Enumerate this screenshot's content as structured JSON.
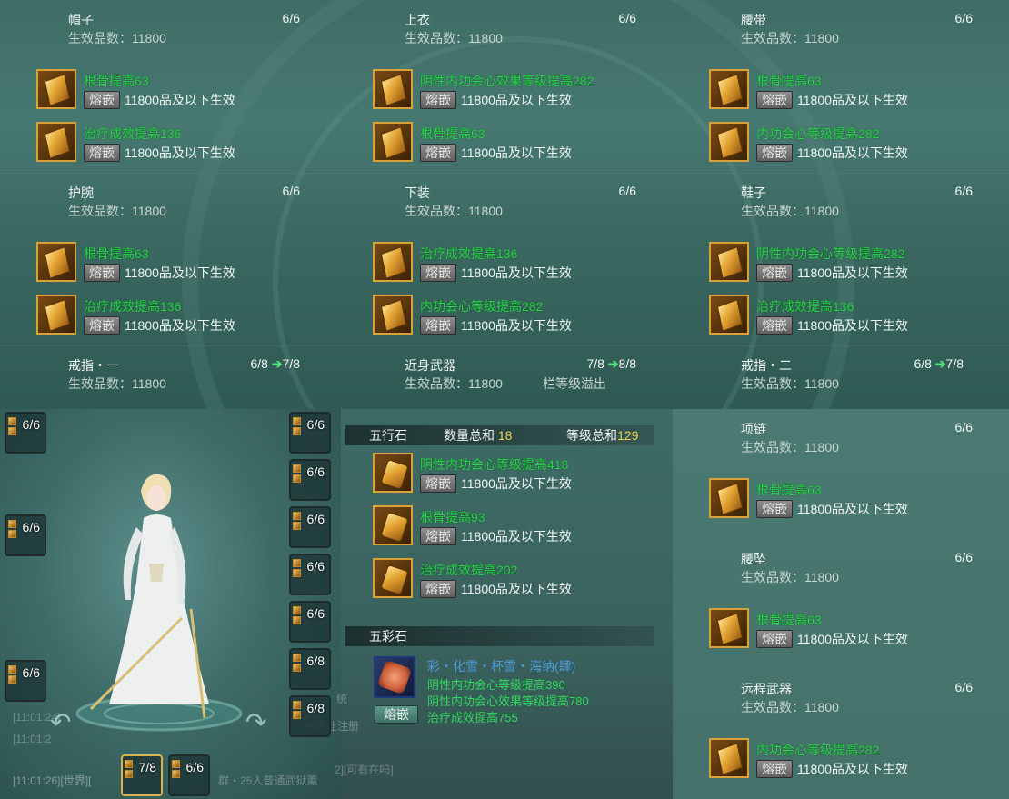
{
  "gear": [
    {
      "id": "hat",
      "name": "帽子",
      "count": "6/6",
      "eff": "生效品数：11800",
      "gems": [
        {
          "attr": "根骨提高63",
          "inlay": "熔嵌",
          "eff": "11800品及以下生效"
        },
        {
          "attr": "治疗成效提高136",
          "inlay": "熔嵌",
          "eff": "11800品及以下生效"
        }
      ]
    },
    {
      "id": "top",
      "name": "上衣",
      "count": "6/6",
      "eff": "生效品数：11800",
      "gems": [
        {
          "attr": "阴性内功会心效果等级提高282",
          "inlay": "熔嵌",
          "eff": "11800品及以下生效"
        },
        {
          "attr": "根骨提高63",
          "inlay": "熔嵌",
          "eff": "11800品及以下生效"
        }
      ]
    },
    {
      "id": "belt",
      "name": "腰带",
      "count": "6/6",
      "eff": "生效品数：11800",
      "gems": [
        {
          "attr": "根骨提高63",
          "inlay": "熔嵌",
          "eff": "11800品及以下生效"
        },
        {
          "attr": "内功会心等级提高282",
          "inlay": "熔嵌",
          "eff": "11800品及以下生效"
        }
      ]
    },
    {
      "id": "wrist",
      "name": "护腕",
      "count": "6/6",
      "eff": "生效品数：11800",
      "gems": [
        {
          "attr": "根骨提高63",
          "inlay": "熔嵌",
          "eff": "11800品及以下生效"
        },
        {
          "attr": "治疗成效提高136",
          "inlay": "熔嵌",
          "eff": "11800品及以下生效"
        }
      ]
    },
    {
      "id": "pants",
      "name": "下装",
      "count": "6/6",
      "eff": "生效品数：11800",
      "gems": [
        {
          "attr": "治疗成效提高136",
          "inlay": "熔嵌",
          "eff": "11800品及以下生效"
        },
        {
          "attr": "内功会心等级提高282",
          "inlay": "熔嵌",
          "eff": "11800品及以下生效"
        }
      ]
    },
    {
      "id": "shoes",
      "name": "鞋子",
      "count": "6/6",
      "eff": "生效品数：11800",
      "gems": [
        {
          "attr": "阴性内功会心等级提高282",
          "inlay": "熔嵌",
          "eff": "11800品及以下生效"
        },
        {
          "attr": "治疗成效提高136",
          "inlay": "熔嵌",
          "eff": "11800品及以下生效"
        }
      ]
    }
  ],
  "ring1": {
    "name": "戒指・一",
    "count": "6/8",
    "count_next": "7/8",
    "eff": "生效品数：11800"
  },
  "weapon": {
    "name": "近身武器",
    "count": "7/8",
    "count_next": "8/8",
    "eff": "生效品数：11800",
    "overflow": "栏等级溢出"
  },
  "ring2": {
    "name": "戒指・二",
    "count": "6/8",
    "count_next": "7/8",
    "eff": "生效品数：11800"
  },
  "arrow": "➔",
  "right_gear": [
    {
      "id": "necklace",
      "name": "项链",
      "count": "6/6",
      "eff": "生效品数：11800",
      "gem": {
        "attr": "根骨提高63",
        "inlay": "熔嵌",
        "eff": "11800品及以下生效"
      }
    },
    {
      "id": "pendant",
      "name": "腰坠",
      "count": "6/6",
      "eff": "生效品数：11800",
      "gem": {
        "attr": "根骨提高63",
        "inlay": "熔嵌",
        "eff": "11800品及以下生效"
      }
    },
    {
      "id": "ranged",
      "name": "远程武器",
      "count": "6/6",
      "eff": "生效品数：11800",
      "gem": {
        "attr": "内功会心等级提高282",
        "inlay": "熔嵌",
        "eff": "11800品及以下生效"
      }
    }
  ],
  "wuxing": {
    "title": "五行石",
    "qty_label": "数量总和",
    "qty": "18",
    "lvl_label": "等级总和",
    "lvl": "129",
    "gems": [
      {
        "attr": "阴性内功会心等级提高418",
        "inlay": "熔嵌",
        "eff": "11800品及以下生效"
      },
      {
        "attr": "根骨提高93",
        "inlay": "熔嵌",
        "eff": "11800品及以下生效"
      },
      {
        "attr": "治疗成效提高202",
        "inlay": "熔嵌",
        "eff": "11800品及以下生效"
      }
    ]
  },
  "wucai": {
    "title": "五彩石",
    "name": "彩・化雪・杯雪・海纳(肆)",
    "inlay": "熔嵌",
    "attrs": [
      "阴性内功会心等级提高390",
      "阴性内功会心效果等级提高780",
      "治疗成效提高755"
    ]
  },
  "slots": {
    "left": [
      "6/6",
      "6/6",
      "6/6"
    ],
    "right": [
      "6/6",
      "6/6",
      "6/6",
      "6/6",
      "6/6",
      "6/8",
      "6/8"
    ],
    "bottom": [
      "7/8",
      "6/6"
    ]
  },
  "chat": {
    "lines": [
      "[11:01:26][世界][",
      "[11:01:2",
      "[11:01:24]"
    ],
    "frags": [
      "2][可有在吗]",
      "统",
      "合奇让注册",
      "群・25人普通武狱薰"
    ]
  }
}
